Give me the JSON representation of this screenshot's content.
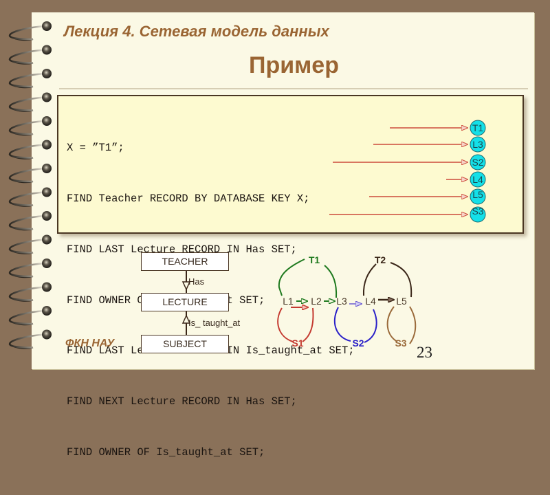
{
  "header": {
    "lecture_title": "Лекция 4. Сетевая модель данных",
    "slide_title": "Пример"
  },
  "code": {
    "lines": [
      "X = ”T1”;",
      "FIND Teacher RECORD BY DATABASE KEY X;",
      "FIND LAST Lecture RECORD IN Has SET;",
      "FIND OWNER OF Is_taught_at SET;",
      "FIND LAST Lecture RECORD IN Is_taught_at SET;",
      "FIND NEXT Lecture RECORD IN Has SET;",
      "FIND OWNER OF Is_taught_at SET;"
    ],
    "results": [
      "T1",
      "L3",
      "S2",
      "L4",
      "L5",
      "S3"
    ],
    "result_color": "#14e0e8",
    "arrow_color": "#cc4a3a"
  },
  "schema": {
    "records": [
      "TEACHER",
      "LECTURE",
      "SUBJECT"
    ],
    "sets": [
      "Has",
      "Is_ taught_at"
    ]
  },
  "network": {
    "owners": [
      {
        "label": "T1",
        "color": "#1f7a1f"
      },
      {
        "label": "T2",
        "color": "#3a2618"
      }
    ],
    "members": [
      "L1",
      "L2",
      "L3",
      "L4",
      "L5"
    ],
    "subjects": [
      {
        "label": "S1",
        "color": "#c43a30"
      },
      {
        "label": "S2",
        "color": "#2a20c8"
      },
      {
        "label": "S3",
        "color": "#9a6a3a"
      }
    ],
    "member_color": "#4a3a2a"
  },
  "footer": {
    "label": "ФКН НАУ",
    "page_number": "23"
  }
}
